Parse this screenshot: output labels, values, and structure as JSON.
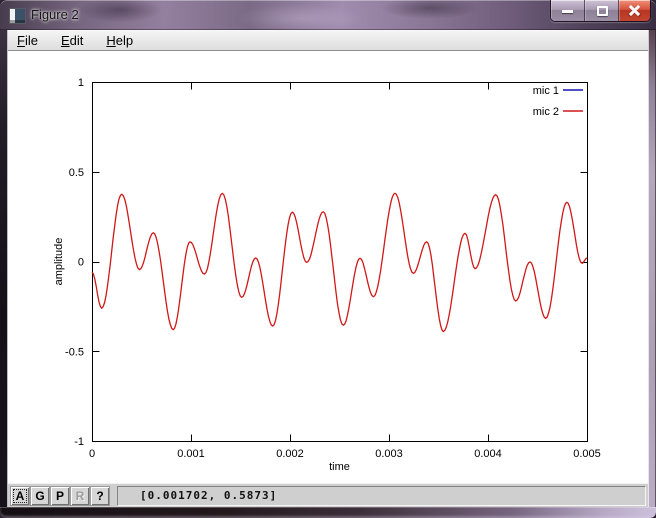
{
  "window": {
    "title": "Figure 2",
    "caption_buttons": [
      {
        "name": "minimize"
      },
      {
        "name": "maximize"
      },
      {
        "name": "close"
      }
    ]
  },
  "menubar": {
    "items": [
      {
        "label": "File"
      },
      {
        "label": "Edit"
      },
      {
        "label": "Help"
      }
    ]
  },
  "toolbar": {
    "buttons": [
      {
        "label": "A",
        "disabled": false,
        "focused": true
      },
      {
        "label": "G",
        "disabled": false
      },
      {
        "label": "P",
        "disabled": false
      },
      {
        "label": "R",
        "disabled": true
      },
      {
        "label": "?",
        "disabled": false
      }
    ],
    "status": "[0.001702, 0.5873]"
  },
  "chart_data": {
    "type": "line",
    "title": "",
    "xlabel": "time",
    "ylabel": "amplitude",
    "xlim": [
      0,
      0.005
    ],
    "ylim": [
      -1,
      1
    ],
    "grid": false,
    "x_ticks": [
      {
        "value": 0,
        "label": "0"
      },
      {
        "value": 0.001,
        "label": "0.001"
      },
      {
        "value": 0.002,
        "label": "0.002"
      },
      {
        "value": 0.003,
        "label": "0.003"
      },
      {
        "value": 0.004,
        "label": "0.004"
      },
      {
        "value": 0.005,
        "label": "0.005"
      }
    ],
    "y_ticks": [
      {
        "value": 1,
        "label": "1"
      },
      {
        "value": 0.5,
        "label": "0.5"
      },
      {
        "value": 0,
        "label": "0"
      },
      {
        "value": -0.5,
        "label": "-0.5"
      },
      {
        "value": -1,
        "label": "-1"
      }
    ],
    "legend": {
      "position": "top-right",
      "entries": [
        {
          "name": "mic 1",
          "color": "#1515b5"
        },
        {
          "name": "mic 2",
          "color": "#d01818"
        }
      ]
    },
    "series": [
      {
        "name": "mic 1",
        "color": "#1515b5",
        "visible": false,
        "keypoints": []
      },
      {
        "name": "mic 2",
        "color": "#d01818",
        "visible": true,
        "keypoints": [
          [
            0.0,
            -0.06
          ],
          [
            9.8e-05,
            -0.26
          ],
          [
            0.0003,
            0.375
          ],
          [
            0.00048,
            -0.045
          ],
          [
            0.00062,
            0.16
          ],
          [
            0.00082,
            -0.38
          ],
          [
            0.00099,
            0.11
          ],
          [
            0.001135,
            -0.07
          ],
          [
            0.001316,
            0.38
          ],
          [
            0.001512,
            -0.2
          ],
          [
            0.001654,
            0.02
          ],
          [
            0.001825,
            -0.36
          ],
          [
            0.002023,
            0.275
          ],
          [
            0.002169,
            -0.005
          ],
          [
            0.002336,
            0.277
          ],
          [
            0.002538,
            -0.355
          ],
          [
            0.002707,
            0.018
          ],
          [
            0.002842,
            -0.196
          ],
          [
            0.003061,
            0.38
          ],
          [
            0.003246,
            -0.066
          ],
          [
            0.003381,
            0.11
          ],
          [
            0.003549,
            -0.39
          ],
          [
            0.003768,
            0.157
          ],
          [
            0.003869,
            -0.04
          ],
          [
            0.004078,
            0.372
          ],
          [
            0.00428,
            -0.22
          ],
          [
            0.004424,
            -0.002
          ],
          [
            0.004583,
            -0.317
          ],
          [
            0.004797,
            0.33
          ],
          [
            0.00495,
            -0.01
          ],
          [
            0.005,
            0.02
          ]
        ]
      }
    ]
  }
}
